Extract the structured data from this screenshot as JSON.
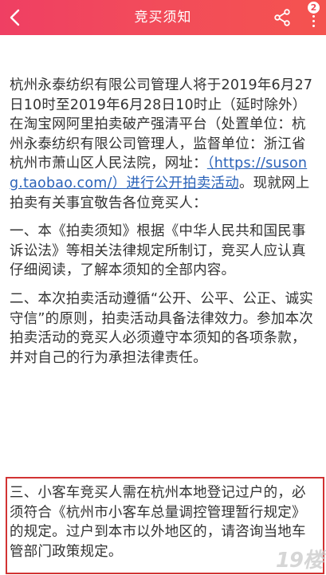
{
  "header": {
    "title": "竞买须知",
    "badge_count": "2"
  },
  "content": {
    "intro_before_link": "杭州永泰纺织有限公司管理人将于2019年6月27日10时至2019年6月28日10时止（延时除外）在淘宝网阿里拍卖破产强清平台（处置单位：杭州永泰纺织有限公司管理人，监督单位：浙江省杭州市萧山区人民法院，网址：",
    "link_text": "（https://susong.taobao.com/）进行公开拍卖活动",
    "intro_after_link": "。现就网上拍卖有关事宜敬告各位竞买人：",
    "section1": "一、本《拍卖须知》根据《中华人民共和国民事诉讼法》等相关法律规定所制订，竞买人应认真仔细阅读，了解本须知的全部内容。",
    "section2": "二、本次拍卖活动遵循“公开、公平、公正、诚实守信”的原则，拍卖活动具备法律效力。参加本次拍卖活动的竞买人必须遵守本须知的各项条款，并对自己的行为承担法律责任。",
    "section3": "三、小客车竞买人需在杭州本地登记过户的，必须符合《杭州市小客车总量调控管理暂行规定》的规定。过户到本市以外地区的，请咨询当地车管部门政策规定。"
  },
  "watermark": "19楼",
  "colors": {
    "header_start": "#ef3f63",
    "header_end": "#f4534f",
    "link": "#2a62b8",
    "highlight_border": "#d23333"
  }
}
